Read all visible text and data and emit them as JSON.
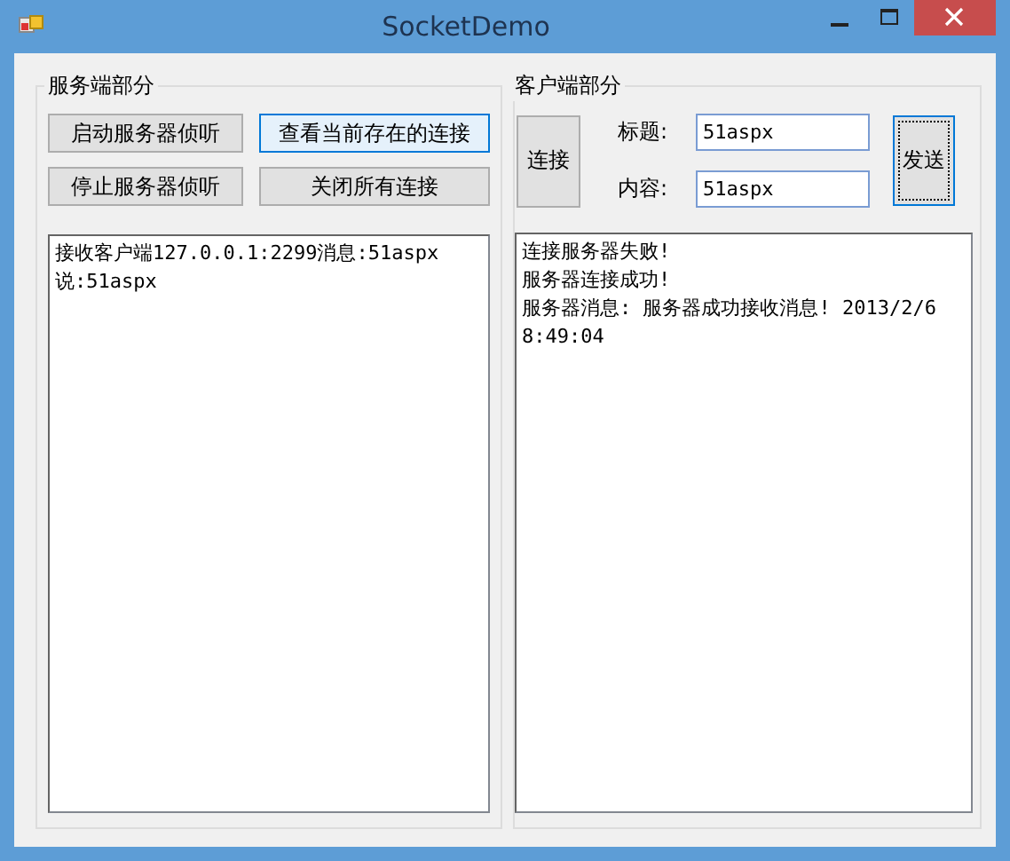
{
  "window": {
    "title": "SocketDemo"
  },
  "server": {
    "title": "服务端部分",
    "buttons": [
      {
        "label": "启动服务器侦听",
        "highlighted": false
      },
      {
        "label": "查看当前存在的连接",
        "highlighted": true
      },
      {
        "label": "停止服务器侦听",
        "highlighted": false
      },
      {
        "label": "关闭所有连接",
        "highlighted": false
      }
    ],
    "log": [
      "接收客户端127.0.0.1:2299消息:51aspx",
      "说:51aspx"
    ]
  },
  "client": {
    "title": "客户端部分",
    "connect_button": {
      "label": "连接",
      "focused": false
    },
    "fields": [
      {
        "label": "标题:",
        "value": "51aspx"
      },
      {
        "label": "内容:",
        "value": "51aspx"
      }
    ],
    "send_button": {
      "label": "发送",
      "focused": true
    },
    "log": [
      "连接服务器失败!",
      "服务器连接成功!",
      "服务器消息: 服务器成功接收消息! 2013/2/6 8:49:04"
    ]
  }
}
